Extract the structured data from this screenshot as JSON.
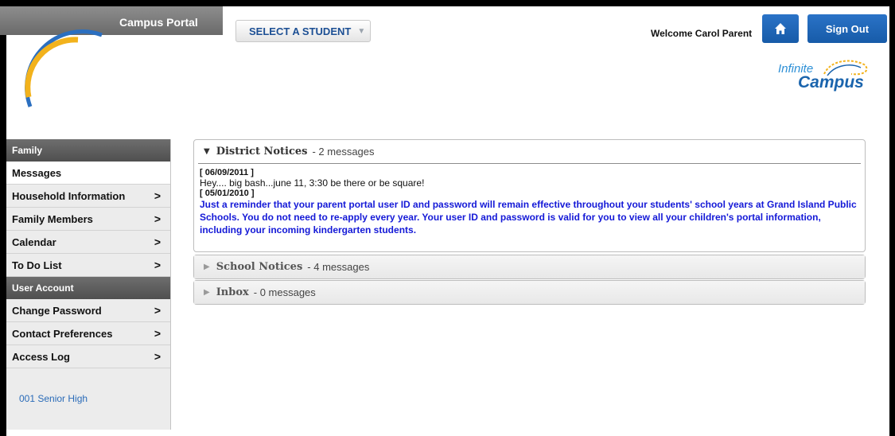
{
  "header": {
    "brand_title": "Campus Portal",
    "select_student_label": "SELECT A STUDENT",
    "welcome_text": "Welcome Carol Parent",
    "sign_out_label": "Sign Out",
    "logo_text_line1": "Infinite",
    "logo_text_line2": "Campus"
  },
  "sidebar": {
    "family_header": "Family",
    "family_items": [
      {
        "label": "Messages"
      },
      {
        "label": "Household Information"
      },
      {
        "label": "Family Members"
      },
      {
        "label": "Calendar"
      },
      {
        "label": "To Do List"
      }
    ],
    "user_header": "User Account",
    "user_items": [
      {
        "label": "Change Password"
      },
      {
        "label": "Contact Preferences"
      },
      {
        "label": "Access Log"
      }
    ],
    "school_link": "001 Senior High"
  },
  "panels": {
    "district": {
      "title": "District Notices",
      "count": "- 2 messages",
      "messages": [
        {
          "date": "[ 06/09/2011 ]",
          "text": "Hey.... big bash...june 11, 3:30 be there or be square!"
        },
        {
          "date": "[ 05/01/2010 ]",
          "text": "Just a reminder that your parent portal user ID and password will remain effective throughout your students' school years at Grand Island Public Schools.  You do not need to re-apply every year.  Your user ID and password is valid for you to view all your children's portal information,  including your incoming kindergarten students."
        }
      ]
    },
    "school": {
      "title": "School Notices",
      "count": "- 4 messages"
    },
    "inbox": {
      "title": "Inbox",
      "count": "- 0 messages"
    }
  },
  "colors": {
    "accent_blue": "#1a64ad",
    "header_gray": "#6a6a6a",
    "message_blue": "#1419d7"
  }
}
